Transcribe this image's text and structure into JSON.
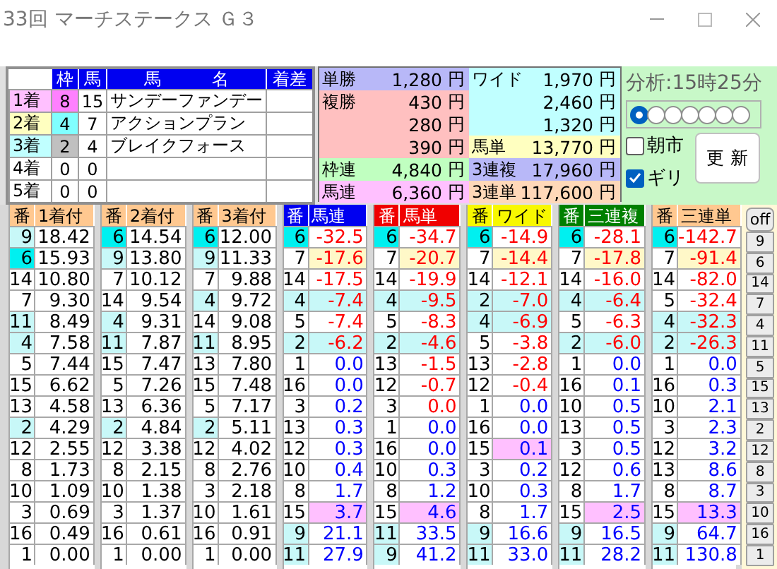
{
  "window": {
    "title": "33回 マーチステークス Ｇ３"
  },
  "results": {
    "columns": [
      "枠",
      "馬",
      "馬　　　名",
      "着差"
    ],
    "rows": [
      {
        "place": "1着",
        "color": "#ffc0ff",
        "frame": {
          "text": "8",
          "color": "#ff80ff"
        },
        "horse": "15",
        "name": "サンデーファンデー"
      },
      {
        "place": "2着",
        "color": "#ffffc0",
        "frame": {
          "text": "4",
          "color": "#80ffff"
        },
        "horse": "7",
        "name": "アクションプラン"
      },
      {
        "place": "3着",
        "color": "#c0ffff",
        "frame": {
          "text": "2",
          "color": "#c0c0c0"
        },
        "horse": "4",
        "name": "ブレイクフォース"
      },
      {
        "place": "4着",
        "frame": {
          "text": "0"
        },
        "horse": "0"
      },
      {
        "place": "5着",
        "frame": {
          "text": "0"
        },
        "horse": "0"
      }
    ]
  },
  "payouts": [
    [
      {
        "label": "単勝",
        "color": "#b8b8f8",
        "lines": [
          {
            "amount": "1,280",
            "unit": "円"
          }
        ]
      },
      {
        "label": "複勝",
        "color": "#ffc0c0",
        "lines": [
          {
            "amount": "430",
            "unit": "円"
          },
          {
            "amount": "280",
            "unit": "円"
          },
          {
            "amount": "390",
            "unit": "円"
          }
        ]
      },
      {
        "label": "枠連",
        "color": "#c0ffc0",
        "lines": [
          {
            "amount": "4,840",
            "unit": "円"
          }
        ]
      },
      {
        "label": "馬連",
        "color": "#ffc0ff",
        "lines": [
          {
            "amount": "6,360",
            "unit": "円"
          }
        ]
      }
    ],
    [
      {
        "label": "ワイド",
        "color": "#c0ffff",
        "lines": [
          {
            "amount": "1,970",
            "unit": "円"
          },
          {
            "amount": "2,460",
            "unit": "円"
          },
          {
            "amount": "1,320",
            "unit": "円"
          }
        ]
      },
      {
        "label": "馬単",
        "color": "#ffffc0",
        "lines": [
          {
            "amount": "13,770",
            "unit": "円"
          }
        ]
      },
      {
        "label": "3連複",
        "color": "#b8b8f8",
        "lines": [
          {
            "amount": "17,960",
            "unit": "円"
          }
        ]
      },
      {
        "label": "3連単",
        "color": "#ffd8b8",
        "lines": [
          {
            "amount": "117,600",
            "unit": "円"
          }
        ]
      }
    ]
  ],
  "analysis": {
    "time": "分析:15時25分",
    "radios": [
      {
        "selected": true
      },
      {
        "selected": false
      },
      {
        "selected": false
      },
      {
        "selected": false
      },
      {
        "selected": false
      },
      {
        "selected": false
      },
      {
        "selected": false
      }
    ],
    "checks": [
      {
        "label": "朝市",
        "checked": false
      },
      {
        "label": "ギリ",
        "checked": true
      }
    ],
    "update_button": "更 新"
  },
  "tables": [
    {
      "columns": [
        "番",
        "1着付"
      ],
      "color": "#ffc890",
      "kind": "dark",
      "rows": [
        {
          "no": "9",
          "value": "18.42",
          "color": "#c8f8f8"
        },
        {
          "no": "6",
          "value": "15.93",
          "color": "#00f0f0"
        },
        {
          "no": "14",
          "value": "10.80"
        },
        {
          "no": "7",
          "value": "9.30"
        },
        {
          "no": "11",
          "value": "8.49",
          "color": "#c8f8f8"
        },
        {
          "no": "4",
          "value": "7.58",
          "color": "#c8f8f8"
        },
        {
          "no": "5",
          "value": "7.44"
        },
        {
          "no": "15",
          "value": "6.62"
        },
        {
          "no": "13",
          "value": "4.58"
        },
        {
          "no": "2",
          "value": "4.29",
          "color": "#c8f8f8"
        },
        {
          "no": "12",
          "value": "2.55"
        },
        {
          "no": "8",
          "value": "1.73"
        },
        {
          "no": "10",
          "value": "1.09"
        },
        {
          "no": "3",
          "value": "0.69"
        },
        {
          "no": "16",
          "value": "0.49"
        },
        {
          "no": "1",
          "value": "0.00"
        }
      ]
    },
    {
      "columns": [
        "番",
        "2着付"
      ],
      "color": "#ffc890",
      "kind": "dark",
      "rows": [
        {
          "no": "6",
          "value": "14.54",
          "color": "#00f0f0"
        },
        {
          "no": "9",
          "value": "13.80",
          "color": "#c8f8f8"
        },
        {
          "no": "7",
          "value": "10.12"
        },
        {
          "no": "14",
          "value": "9.54"
        },
        {
          "no": "4",
          "value": "9.31",
          "color": "#c8f8f8"
        },
        {
          "no": "11",
          "value": "7.87",
          "color": "#c8f8f8"
        },
        {
          "no": "15",
          "value": "7.47"
        },
        {
          "no": "5",
          "value": "7.26"
        },
        {
          "no": "13",
          "value": "6.36"
        },
        {
          "no": "2",
          "value": "4.84",
          "color": "#c8f8f8"
        },
        {
          "no": "12",
          "value": "3.38"
        },
        {
          "no": "8",
          "value": "2.15"
        },
        {
          "no": "10",
          "value": "1.38"
        },
        {
          "no": "3",
          "value": "1.37"
        },
        {
          "no": "16",
          "value": "0.61"
        },
        {
          "no": "1",
          "value": "0.00"
        }
      ]
    },
    {
      "columns": [
        "番",
        "3着付"
      ],
      "color": "#ffc890",
      "kind": "dark",
      "rows": [
        {
          "no": "6",
          "value": "12.00",
          "color": "#00f0f0"
        },
        {
          "no": "9",
          "value": "11.33",
          "color": "#c8f8f8"
        },
        {
          "no": "7",
          "value": "9.88"
        },
        {
          "no": "4",
          "value": "9.72",
          "color": "#c8f8f8"
        },
        {
          "no": "14",
          "value": "9.08"
        },
        {
          "no": "11",
          "value": "8.95",
          "color": "#c8f8f8"
        },
        {
          "no": "13",
          "value": "7.80"
        },
        {
          "no": "15",
          "value": "7.48"
        },
        {
          "no": "5",
          "value": "7.17"
        },
        {
          "no": "2",
          "value": "5.11",
          "color": "#c8f8f8"
        },
        {
          "no": "12",
          "value": "4.02"
        },
        {
          "no": "8",
          "value": "2.76"
        },
        {
          "no": "3",
          "value": "2.18"
        },
        {
          "no": "10",
          "value": "1.61"
        },
        {
          "no": "16",
          "value": "0.91"
        },
        {
          "no": "1",
          "value": "0.00"
        }
      ]
    },
    {
      "columns": [
        "番",
        "馬連"
      ],
      "color": "#0000f0",
      "kind": "light",
      "rows": [
        {
          "no": "6",
          "value": "-32.5",
          "color": "#00f0f0",
          "kind": "down"
        },
        {
          "no": "7",
          "value": "-17.6",
          "value_cell": {
            "color": "#fff8c8"
          },
          "kind": "down"
        },
        {
          "no": "14",
          "value": "-17.5",
          "kind": "down"
        },
        {
          "no": "4",
          "value": "-7.4",
          "color": "#c8f8f8",
          "value_cell": {
            "color": "#c8f8f8"
          },
          "kind": "down"
        },
        {
          "no": "5",
          "value": "-7.4",
          "kind": "down"
        },
        {
          "no": "2",
          "value": "-6.2",
          "color": "#c8f8f8",
          "value_cell": {
            "color": "#c8f8f8"
          },
          "kind": "down"
        },
        {
          "no": "1",
          "value": "0.0",
          "kind": "up"
        },
        {
          "no": "16",
          "value": "0.0",
          "kind": "up"
        },
        {
          "no": "3",
          "value": "0.2",
          "kind": "up"
        },
        {
          "no": "13",
          "value": "0.3",
          "kind": "up"
        },
        {
          "no": "12",
          "value": "0.3",
          "kind": "up"
        },
        {
          "no": "10",
          "value": "0.4",
          "kind": "up"
        },
        {
          "no": "8",
          "value": "1.7",
          "kind": "up"
        },
        {
          "no": "15",
          "value": "3.7",
          "value_cell": {
            "color": "#ffc0ff"
          },
          "kind": "up"
        },
        {
          "no": "9",
          "value": "21.1",
          "color": "#c8f8f8",
          "kind": "up"
        },
        {
          "no": "11",
          "value": "27.9",
          "color": "#c8f8f8",
          "kind": "up"
        }
      ]
    },
    {
      "columns": [
        "番",
        "馬単"
      ],
      "color": "#f00000",
      "kind": "light",
      "rows": [
        {
          "no": "6",
          "value": "-34.7",
          "color": "#00f0f0",
          "kind": "down"
        },
        {
          "no": "7",
          "value": "-20.7",
          "value_cell": {
            "color": "#fff8c8"
          },
          "kind": "down"
        },
        {
          "no": "14",
          "value": "-19.9",
          "kind": "down"
        },
        {
          "no": "4",
          "value": "-9.5",
          "color": "#c8f8f8",
          "value_cell": {
            "color": "#c8f8f8"
          },
          "kind": "down"
        },
        {
          "no": "5",
          "value": "-8.3",
          "kind": "down"
        },
        {
          "no": "2",
          "value": "-4.6",
          "color": "#c8f8f8",
          "value_cell": {
            "color": "#c8f8f8"
          },
          "kind": "down"
        },
        {
          "no": "13",
          "value": "-1.5",
          "kind": "down"
        },
        {
          "no": "12",
          "value": "-0.7",
          "kind": "down"
        },
        {
          "no": "3",
          "value": "0.0",
          "kind": "down"
        },
        {
          "no": "1",
          "value": "0.0",
          "kind": "up"
        },
        {
          "no": "16",
          "value": "0.0",
          "kind": "up"
        },
        {
          "no": "10",
          "value": "0.3",
          "kind": "up"
        },
        {
          "no": "8",
          "value": "1.2",
          "kind": "up"
        },
        {
          "no": "15",
          "value": "4.6",
          "value_cell": {
            "color": "#ffc0ff"
          },
          "kind": "up"
        },
        {
          "no": "11",
          "value": "33.5",
          "color": "#c8f8f8",
          "kind": "up"
        },
        {
          "no": "9",
          "value": "41.2",
          "color": "#c8f8f8",
          "kind": "up"
        }
      ]
    },
    {
      "columns": [
        "番",
        "ワイド"
      ],
      "color": "#f8f800",
      "kind": "dark",
      "rows": [
        {
          "no": "6",
          "value": "-14.9",
          "color": "#00f0f0",
          "kind": "down"
        },
        {
          "no": "7",
          "value": "-14.4",
          "value_cell": {
            "color": "#fff8c8"
          },
          "kind": "down"
        },
        {
          "no": "14",
          "value": "-12.1",
          "kind": "down"
        },
        {
          "no": "2",
          "value": "-7.0",
          "color": "#c8f8f8",
          "value_cell": {
            "color": "#c8f8f8"
          },
          "kind": "down"
        },
        {
          "no": "4",
          "value": "-6.9",
          "color": "#c8f8f8",
          "value_cell": {
            "color": "#c8f8f8"
          },
          "kind": "down"
        },
        {
          "no": "5",
          "value": "-3.8",
          "kind": "down"
        },
        {
          "no": "13",
          "value": "-2.8",
          "kind": "down"
        },
        {
          "no": "12",
          "value": "-0.4",
          "kind": "down"
        },
        {
          "no": "1",
          "value": "0.0",
          "kind": "up"
        },
        {
          "no": "16",
          "value": "0.0",
          "kind": "up"
        },
        {
          "no": "15",
          "value": "0.1",
          "value_cell": {
            "color": "#ffc0ff"
          },
          "kind": "up"
        },
        {
          "no": "3",
          "value": "0.2",
          "kind": "up"
        },
        {
          "no": "10",
          "value": "0.3",
          "kind": "up"
        },
        {
          "no": "8",
          "value": "1.7",
          "kind": "up"
        },
        {
          "no": "9",
          "value": "16.6",
          "color": "#c8f8f8",
          "kind": "up"
        },
        {
          "no": "11",
          "value": "33.0",
          "color": "#c8f8f8",
          "kind": "up"
        }
      ]
    },
    {
      "columns": [
        "番",
        "三連複"
      ],
      "color": "#008000",
      "kind": "light",
      "rows": [
        {
          "no": "6",
          "value": "-28.1",
          "color": "#00f0f0",
          "kind": "down"
        },
        {
          "no": "7",
          "value": "-17.8",
          "value_cell": {
            "color": "#fff8c8"
          },
          "kind": "down"
        },
        {
          "no": "14",
          "value": "-16.0",
          "kind": "down"
        },
        {
          "no": "4",
          "value": "-6.4",
          "color": "#c8f8f8",
          "value_cell": {
            "color": "#c8f8f8"
          },
          "kind": "down"
        },
        {
          "no": "5",
          "value": "-6.3",
          "kind": "down"
        },
        {
          "no": "2",
          "value": "-6.0",
          "color": "#c8f8f8",
          "value_cell": {
            "color": "#c8f8f8"
          },
          "kind": "down"
        },
        {
          "no": "1",
          "value": "0.0",
          "kind": "up"
        },
        {
          "no": "16",
          "value": "0.1",
          "kind": "up"
        },
        {
          "no": "10",
          "value": "0.5",
          "kind": "up"
        },
        {
          "no": "13",
          "value": "0.5",
          "kind": "up"
        },
        {
          "no": "3",
          "value": "0.5",
          "kind": "up"
        },
        {
          "no": "12",
          "value": "0.6",
          "kind": "up"
        },
        {
          "no": "8",
          "value": "1.7",
          "kind": "up"
        },
        {
          "no": "15",
          "value": "2.5",
          "value_cell": {
            "color": "#ffc0ff"
          },
          "kind": "up"
        },
        {
          "no": "9",
          "value": "16.5",
          "color": "#c8f8f8",
          "kind": "up"
        },
        {
          "no": "11",
          "value": "28.2",
          "color": "#c8f8f8",
          "kind": "up"
        }
      ]
    },
    {
      "columns": [
        "番",
        "三連単"
      ],
      "color": "#ffc890",
      "kind": "dark",
      "rows": [
        {
          "no": "6",
          "value": "-142.7",
          "color": "#00f0f0",
          "kind": "down"
        },
        {
          "no": "7",
          "value": "-91.4",
          "value_cell": {
            "color": "#fff8c8"
          },
          "kind": "down"
        },
        {
          "no": "14",
          "value": "-82.0",
          "kind": "down"
        },
        {
          "no": "5",
          "value": "-32.4",
          "kind": "down"
        },
        {
          "no": "4",
          "value": "-32.3",
          "color": "#c8f8f8",
          "value_cell": {
            "color": "#c8f8f8"
          },
          "kind": "down"
        },
        {
          "no": "2",
          "value": "-26.3",
          "color": "#c8f8f8",
          "value_cell": {
            "color": "#c8f8f8"
          },
          "kind": "down"
        },
        {
          "no": "1",
          "value": "0.0",
          "kind": "up"
        },
        {
          "no": "16",
          "value": "0.3",
          "kind": "up"
        },
        {
          "no": "10",
          "value": "2.1",
          "kind": "up"
        },
        {
          "no": "3",
          "value": "2.3",
          "kind": "up"
        },
        {
          "no": "12",
          "value": "3.2",
          "kind": "up"
        },
        {
          "no": "13",
          "value": "8.6",
          "kind": "up"
        },
        {
          "no": "8",
          "value": "8.7",
          "kind": "up"
        },
        {
          "no": "15",
          "value": "13.3",
          "value_cell": {
            "color": "#ffc0ff"
          },
          "kind": "up"
        },
        {
          "no": "9",
          "value": "64.7",
          "color": "#c8f8f8",
          "kind": "up"
        },
        {
          "no": "11",
          "value": "130.8",
          "color": "#c8f8f8",
          "kind": "up"
        }
      ]
    }
  ],
  "side_buttons": [
    "off",
    "9",
    "6",
    "14",
    "7",
    "4",
    "11",
    "5",
    "15",
    "13",
    "2",
    "12",
    "8",
    "3",
    "10",
    "16",
    "1"
  ]
}
